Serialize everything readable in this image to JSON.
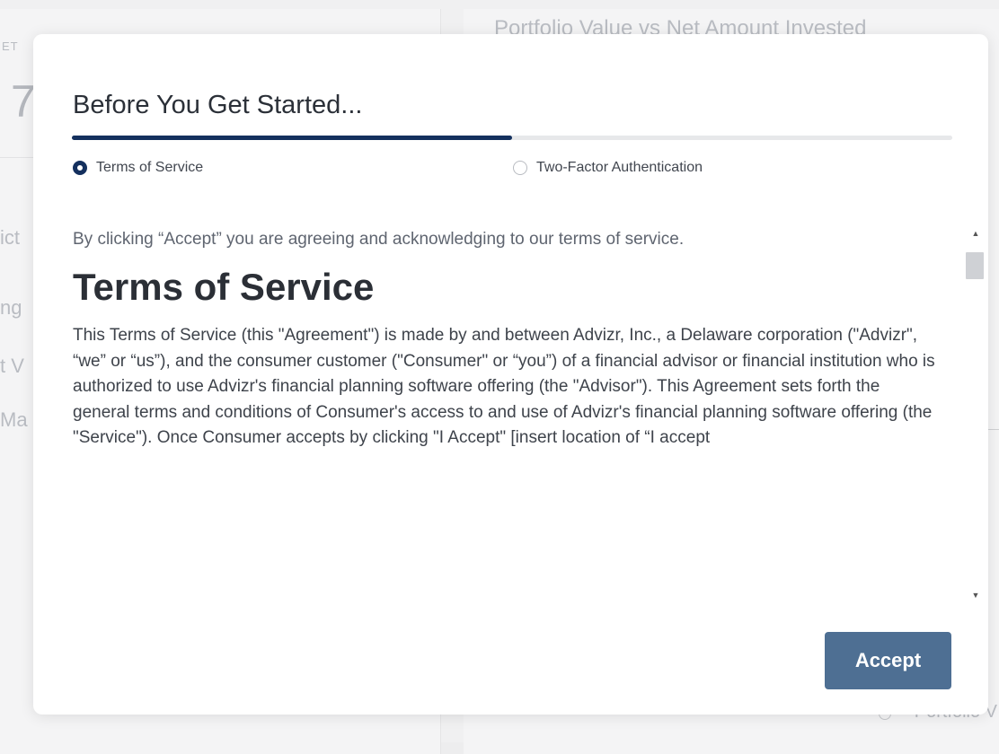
{
  "background": {
    "chart_title": "Portfolio Value vs Net Amount Invested",
    "label_small": "ET",
    "big_number": "7",
    "side_labels": [
      "ict",
      "ng",
      "t V",
      "Ma"
    ],
    "legend_label": "Portfolio V"
  },
  "modal": {
    "title": "Before You Get Started...",
    "progress_fraction": 0.5,
    "steps": [
      {
        "label": "Terms of Service",
        "selected": true
      },
      {
        "label": "Two-Factor Authentication",
        "selected": false
      }
    ],
    "intro": "By clicking “Accept” you are agreeing and acknowledging to our terms of service.",
    "heading": "Terms of Service",
    "body": "This Terms of Service (this \"Agreement\") is made by and between Advizr, Inc., a Delaware corporation (\"Advizr\", “we” or “us”), and the consumer customer (\"Consumer\" or “you”) of a financial advisor or financial institution who is authorized to use Advizr's financial planning software offering (the \"Advisor\"). This Agreement sets forth the general terms and conditions of Consumer's access to and use of Advizr's financial planning software offering (the \"Service\"). Once Consumer accepts by clicking \"I Accept\" [insert location of “I accept",
    "accept_label": "Accept"
  },
  "colors": {
    "accent": "#14305e",
    "button": "#4e6f93"
  }
}
